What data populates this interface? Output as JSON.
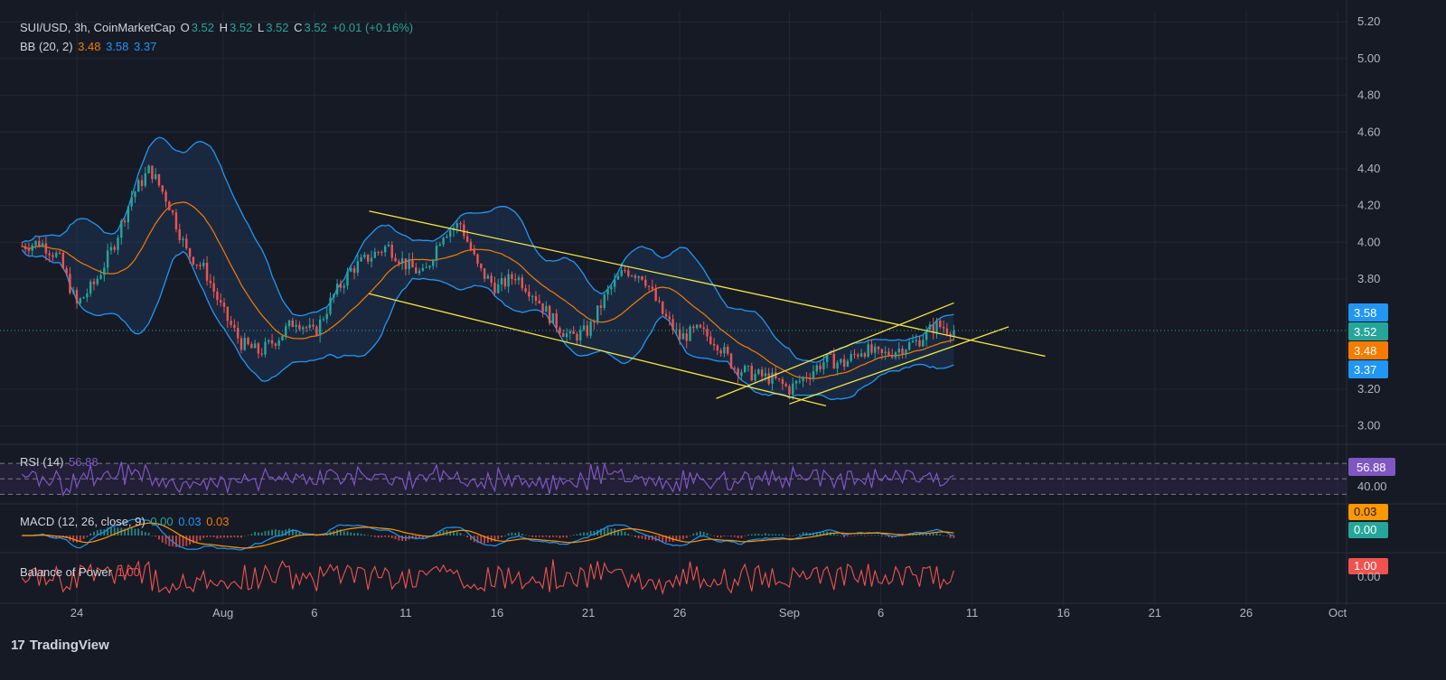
{
  "header": {
    "symbol": "SUI/USD, 3h, CoinMarketCap",
    "open_label": "O",
    "open": "3.52",
    "high_label": "H",
    "high": "3.52",
    "low_label": "L",
    "low": "3.52",
    "close_label": "C",
    "close": "3.52",
    "change": "+0.01 (+0.16%)"
  },
  "bb_legend": {
    "name": "BB (20, 2)",
    "basis": "3.48",
    "upper": "3.58",
    "lower": "3.37"
  },
  "rsi_legend": {
    "name": "RSI (14)",
    "value": "56.88"
  },
  "macd_legend": {
    "name": "MACD (12, 26, close, 9)",
    "macd": "0.00",
    "signal": "0.03",
    "hist": "0.03"
  },
  "bop_legend": {
    "name": "Balance of Power",
    "value": "1.00"
  },
  "branding": {
    "logo_text": "TradingView",
    "logo_mark": "17"
  },
  "colors": {
    "background": "#161a25",
    "grid": "#232734",
    "text": "#b2b5be",
    "up": "#26a69a",
    "down": "#ef5350",
    "bb_band": "#2196f3",
    "bb_basis": "#f57c00",
    "bb_fill": "#1e3a5f",
    "trendline": "#f4e542",
    "rsi_line": "#7e57c2",
    "rsi_fill": "#3a2b57",
    "macd_line": "#2196f3",
    "signal_line": "#ff9800",
    "bop_line": "#ef5350",
    "price_line": "#26a69a"
  },
  "chart_data": [
    {
      "type": "candlestick",
      "title": "SUI/USD, 3h, CoinMarketCap",
      "y_ticks": [
        "5.20",
        "5.00",
        "4.80",
        "4.60",
        "4.40",
        "4.20",
        "4.00",
        "3.80",
        "3.20",
        "3.00"
      ],
      "ylim": [
        2.92,
        5.26
      ],
      "x_ticks": [
        "24",
        "Aug",
        "6",
        "11",
        "16",
        "21",
        "26",
        "Sep",
        "6",
        "11",
        "16",
        "21",
        "26",
        "Oct"
      ],
      "x_tick_dates": [
        "2024-07-24",
        "2024-08-01",
        "2024-08-06",
        "2024-08-11",
        "2024-08-16",
        "2024-08-21",
        "2024-08-26",
        "2024-09-01",
        "2024-09-06",
        "2024-09-11",
        "2024-09-16",
        "2024-09-21",
        "2024-09-26",
        "2024-10-01"
      ],
      "close_path": [
        [
          "2024-07-21",
          3.98
        ],
        [
          "2024-07-22",
          4.0
        ],
        [
          "2024-07-23",
          3.92
        ],
        [
          "2024-07-24",
          3.66
        ],
        [
          "2024-07-25",
          3.78
        ],
        [
          "2024-07-26",
          3.98
        ],
        [
          "2024-07-27",
          4.25
        ],
        [
          "2024-07-28",
          4.4
        ],
        [
          "2024-07-29",
          4.22
        ],
        [
          "2024-07-30",
          3.95
        ],
        [
          "2024-07-31",
          3.85
        ],
        [
          "2024-08-01",
          3.62
        ],
        [
          "2024-08-02",
          3.45
        ],
        [
          "2024-08-03",
          3.4
        ],
        [
          "2024-08-04",
          3.48
        ],
        [
          "2024-08-05",
          3.58
        ],
        [
          "2024-08-06",
          3.5
        ],
        [
          "2024-08-07",
          3.7
        ],
        [
          "2024-08-08",
          3.85
        ],
        [
          "2024-08-09",
          3.92
        ],
        [
          "2024-08-10",
          3.98
        ],
        [
          "2024-08-11",
          3.88
        ],
        [
          "2024-08-12",
          3.82
        ],
        [
          "2024-08-13",
          4.05
        ],
        [
          "2024-08-14",
          4.1
        ],
        [
          "2024-08-15",
          3.85
        ],
        [
          "2024-08-16",
          3.75
        ],
        [
          "2024-08-17",
          3.82
        ],
        [
          "2024-08-18",
          3.72
        ],
        [
          "2024-08-19",
          3.58
        ],
        [
          "2024-08-20",
          3.48
        ],
        [
          "2024-08-21",
          3.52
        ],
        [
          "2024-08-22",
          3.72
        ],
        [
          "2024-08-23",
          3.85
        ],
        [
          "2024-08-24",
          3.82
        ],
        [
          "2024-08-25",
          3.62
        ],
        [
          "2024-08-26",
          3.48
        ],
        [
          "2024-08-27",
          3.52
        ],
        [
          "2024-08-28",
          3.46
        ],
        [
          "2024-08-29",
          3.32
        ],
        [
          "2024-08-30",
          3.28
        ],
        [
          "2024-08-31",
          3.26
        ],
        [
          "2024-09-01",
          3.2
        ],
        [
          "2024-09-02",
          3.28
        ],
        [
          "2024-09-03",
          3.36
        ],
        [
          "2024-09-04",
          3.34
        ],
        [
          "2024-09-05",
          3.42
        ],
        [
          "2024-09-06",
          3.38
        ],
        [
          "2024-09-07",
          3.42
        ],
        [
          "2024-09-08",
          3.46
        ],
        [
          "2024-09-09",
          3.55
        ],
        [
          "2024-09-10",
          3.52
        ]
      ],
      "last_price": 3.52,
      "bollinger_bands": {
        "period": 20,
        "stddev": 2,
        "basis": 3.48,
        "upper": 3.58,
        "lower": 3.37
      },
      "price_labels": [
        {
          "value": "3.58",
          "series": "upper"
        },
        {
          "value": "3.52",
          "series": "price"
        },
        {
          "value": "3.48",
          "series": "basis"
        },
        {
          "value": "3.37",
          "series": "lower"
        }
      ],
      "trendlines": [
        {
          "from": [
            "2024-08-09",
            4.17
          ],
          "to": [
            "2024-09-15",
            3.38
          ]
        },
        {
          "from": [
            "2024-08-09",
            3.72
          ],
          "to": [
            "2024-09-03",
            3.11
          ]
        },
        {
          "from": [
            "2024-08-28",
            3.15
          ],
          "to": [
            "2024-09-10",
            3.67
          ]
        },
        {
          "from": [
            "2024-09-01",
            3.12
          ],
          "to": [
            "2024-09-13",
            3.54
          ]
        }
      ],
      "grid": true
    },
    {
      "type": "line",
      "title": "RSI (14)",
      "last": 56.88,
      "y_ticks": [
        "40.00"
      ],
      "levels": [
        30,
        50,
        70
      ]
    },
    {
      "type": "line",
      "title": "MACD (12, 26, close, 9)",
      "macd": 0.0,
      "signal": 0.03,
      "histogram": 0.03,
      "value_labels": [
        "0.03",
        "0.00"
      ]
    },
    {
      "type": "line",
      "title": "Balance of Power",
      "last": 1.0,
      "y_ticks": [
        "0.00"
      ],
      "value_labels": [
        "1.00"
      ]
    }
  ]
}
